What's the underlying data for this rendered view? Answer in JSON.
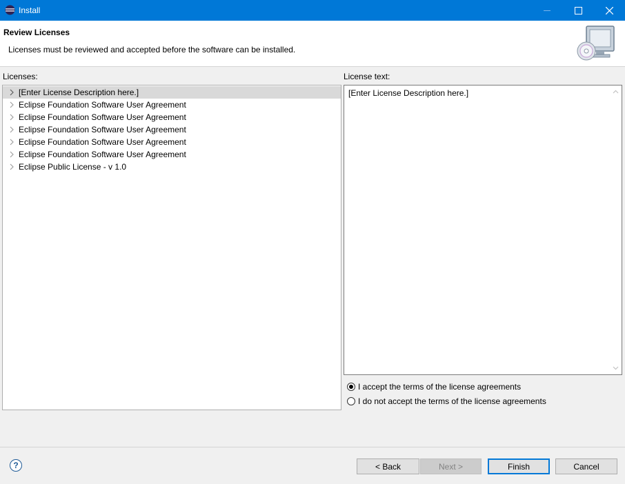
{
  "window": {
    "title": "Install",
    "controls": {
      "minimize_icon": "minimize-icon",
      "maximize_icon": "maximize-icon",
      "close_icon": "close-icon"
    }
  },
  "header": {
    "title": "Review Licenses",
    "description": "Licenses must be reviewed and accepted before the software can be installed."
  },
  "licenses": {
    "label": "Licenses:",
    "items": [
      {
        "label": "[Enter License Description here.]",
        "selected": true
      },
      {
        "label": "Eclipse Foundation Software User Agreement"
      },
      {
        "label": "Eclipse Foundation Software User Agreement"
      },
      {
        "label": "Eclipse Foundation Software User Agreement"
      },
      {
        "label": "Eclipse Foundation Software User Agreement"
      },
      {
        "label": "Eclipse Foundation Software User Agreement"
      },
      {
        "label": "Eclipse Public License - v 1.0"
      }
    ]
  },
  "license_text": {
    "label": "License text:",
    "content": "[Enter License Description here.]"
  },
  "agreement": {
    "accept_label": "I accept the terms of the license agreements",
    "decline_label": "I do not accept the terms of the license agreements",
    "selected": "accept"
  },
  "footer": {
    "help_symbol": "?",
    "back_label": "< Back",
    "next_label": "Next >",
    "finish_label": "Finish",
    "cancel_label": "Cancel"
  },
  "colors": {
    "titlebar": "#0078d7",
    "selection": "#d9d9d9",
    "default_button_border": "#0078d7"
  }
}
